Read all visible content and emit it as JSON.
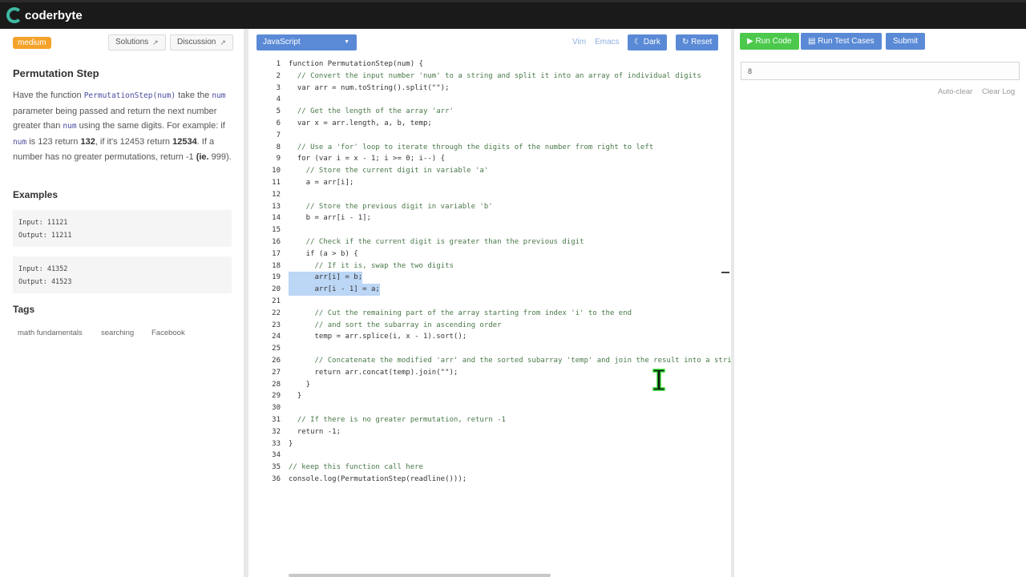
{
  "app": {
    "brand": "coderbyte",
    "brand_color": "#3fb8a3"
  },
  "left_panel": {
    "difficulty": "medium",
    "solutions_label": "Solutions",
    "discussion_label": "Discussion",
    "title": "Permutation Step",
    "description": {
      "p1": "Have the function",
      "fn": "PermutationStep(num)",
      "p2": "take the",
      "num1": "num",
      "p3": "parameter being passed and return the next number greater than",
      "num2": "num",
      "p4": "using the same digits. For example: if",
      "num3": "num",
      "p5": "is 123 return",
      "b1": "132",
      "p6": ", if it's 12453 return",
      "b2": "12534",
      "p7": ". If a number has no greater permutations, return -1",
      "b3": "(ie.",
      "p8": "999)."
    },
    "examples_heading": "Examples",
    "examples": [
      {
        "input": "Input: 11121",
        "output": "Output: 11211"
      },
      {
        "input": "Input: 41352",
        "output": "Output: 41523"
      }
    ],
    "tags_heading": "Tags",
    "tags": [
      "math fundamentals",
      "searching",
      "Facebook"
    ]
  },
  "editor": {
    "language": "JavaScript",
    "vim_label": "Vim",
    "emacs_label": "Emacs",
    "dark_label": "Dark",
    "reset_label": "Reset",
    "line_numbers": [
      "1",
      "2",
      "3",
      "4",
      "5",
      "6",
      "7",
      "8",
      "9",
      "10",
      "11",
      "12",
      "13",
      "14",
      "15",
      "16",
      "17",
      "18",
      "19",
      "20",
      "21",
      "22",
      "23",
      "24",
      "25",
      "26",
      "27",
      "28",
      "29",
      "30",
      "31",
      "32",
      "33",
      "34",
      "35",
      "36"
    ],
    "lines": [
      "function PermutationStep(num) {",
      "  // Convert the input number 'num' to a string and split it into an array of individual digits",
      "  var arr = num.toString().split(\"\");",
      "",
      "  // Get the length of the array 'arr'",
      "  var x = arr.length, a, b, temp;",
      "",
      "  // Use a 'for' loop to iterate through the digits of the number from right to left",
      "  for (var i = x - 1; i >= 0; i--) {",
      "    // Store the current digit in variable 'a'",
      "    a = arr[i];",
      "",
      "    // Store the previous digit in variable 'b'",
      "    b = arr[i - 1];",
      "",
      "    // Check if the current digit is greater than the previous digit",
      "    if (a > b) {",
      "      // If it is, swap the two digits",
      "      arr[i] = b;",
      "      arr[i - 1] = a;",
      "",
      "      // Cut the remaining part of the array starting from index 'i' to the end",
      "      // and sort the subarray in ascending order",
      "      temp = arr.splice(i, x - 1).sort();",
      "",
      "      // Concatenate the modified 'arr' and the sorted subarray 'temp' and join the result into a string",
      "      return arr.concat(temp).join(\"\");",
      "    }",
      "  }",
      "",
      "  // If there is no greater permutation, return -1",
      "  return -1;",
      "}",
      "",
      "// keep this function call here",
      "console.log(PermutationStep(readline()));"
    ]
  },
  "console": {
    "run_code_label": "Run Code",
    "run_tests_label": "Run Test Cases",
    "submit_label": "Submit",
    "input_value": "8",
    "auto_clear_label": "Auto-clear",
    "clear_log_label": "Clear Log",
    "colors": {
      "run": "#4cc94c",
      "tests": "#5a8ad6",
      "submit": "#5a8ad6"
    }
  }
}
